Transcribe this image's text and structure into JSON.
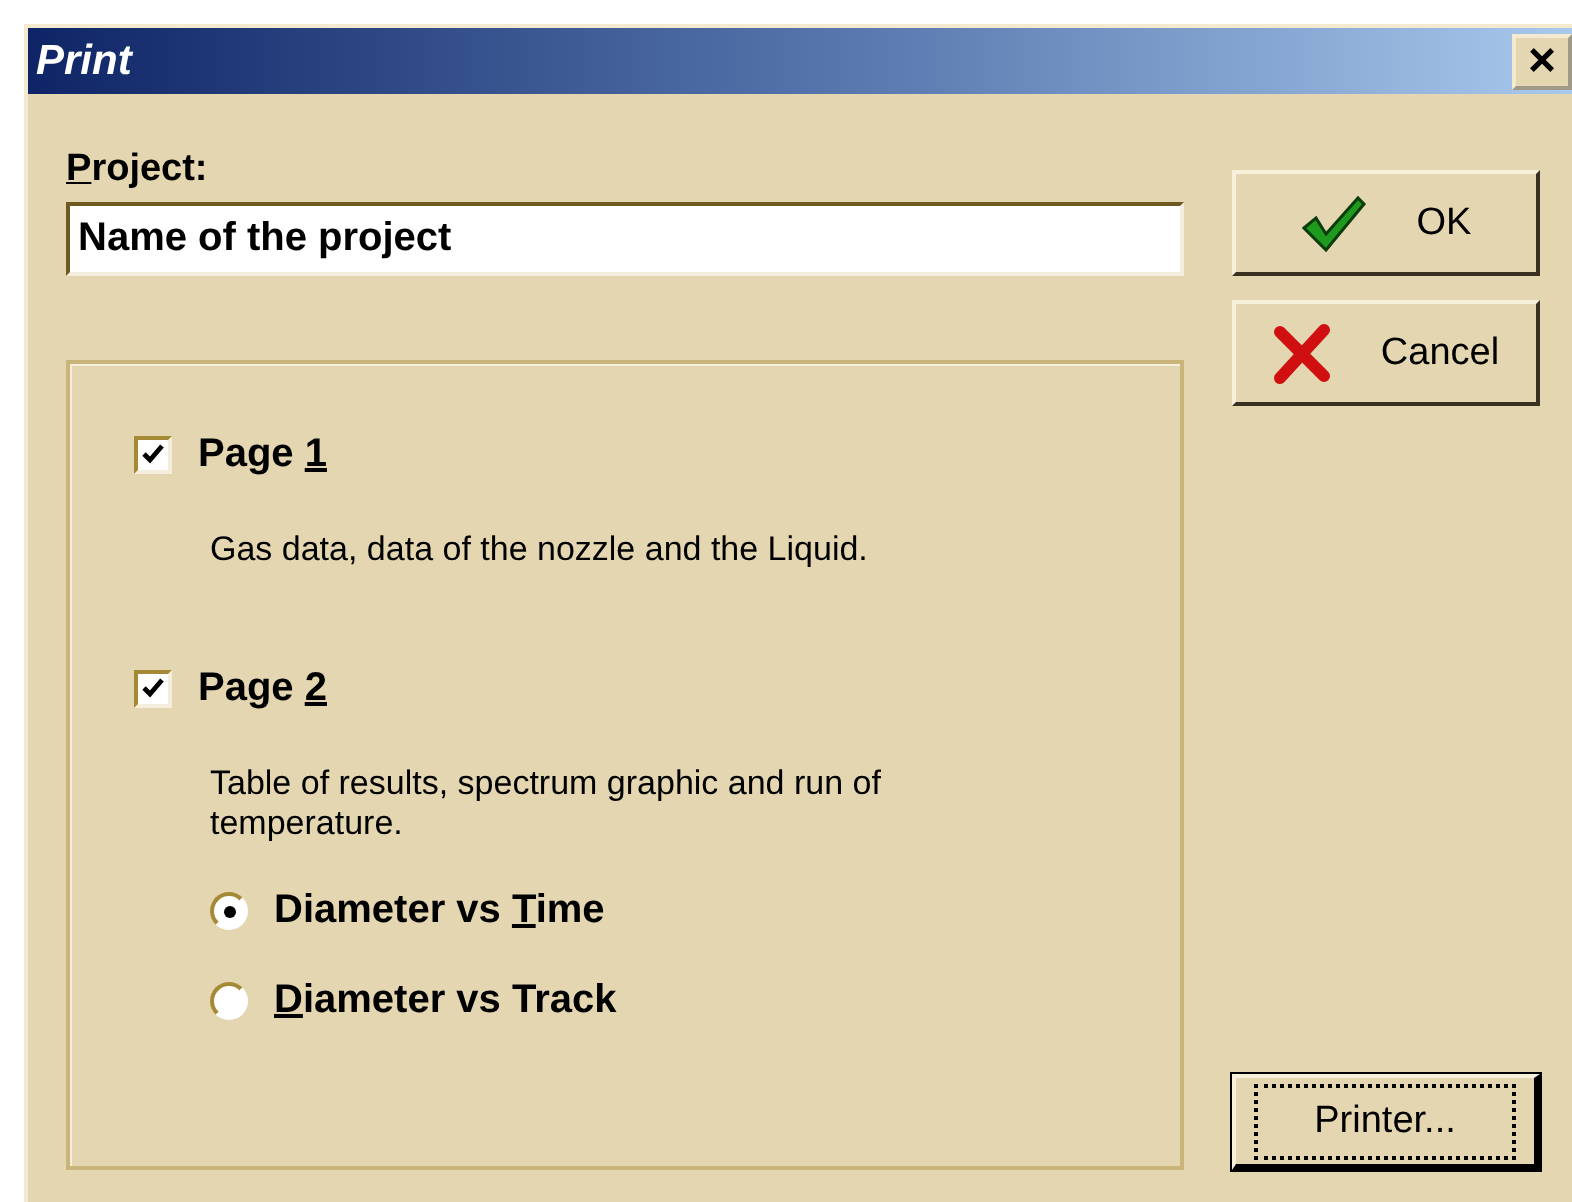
{
  "window": {
    "title": "Print",
    "close": "×"
  },
  "project": {
    "label": {
      "key": "P",
      "post": "roject:"
    },
    "value": "Name of the project"
  },
  "buttons": [
    {
      "kind": "ok",
      "label": "OK"
    },
    {
      "kind": "cancel",
      "label": "Cancel"
    },
    {
      "kind": "printer",
      "label": "Printer...",
      "focused": true
    }
  ],
  "pages": [
    {
      "label": {
        "pre": "Page ",
        "key": "1"
      },
      "checked": true,
      "description": "Gas data, data of the nozzle and the Liquid."
    },
    {
      "label": {
        "pre": "Page ",
        "key": "2"
      },
      "checked": true,
      "description": "Table of results, spectrum graphic and run of temperature.",
      "options": [
        {
          "label": {
            "pre": "Diameter vs ",
            "key": "T",
            "post": "ime"
          },
          "selected": true
        },
        {
          "label": {
            "key": "D",
            "post": "iameter vs Track"
          },
          "selected": false
        }
      ]
    }
  ]
}
